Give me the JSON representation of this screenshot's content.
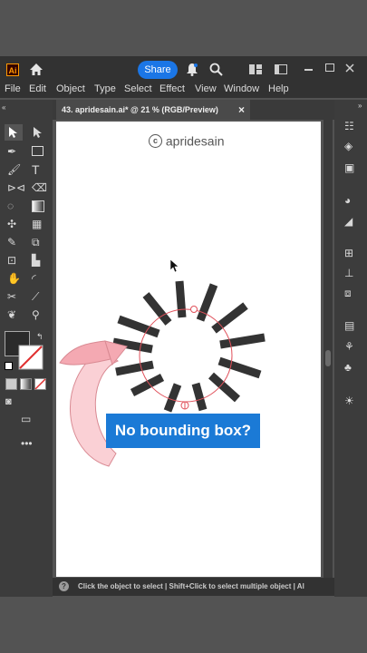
{
  "app": {
    "logo": "Ai",
    "share_label": "Share"
  },
  "menu": [
    "File",
    "Edit",
    "Object",
    "Type",
    "Select",
    "Effect",
    "View",
    "Window",
    "Help"
  ],
  "document": {
    "tab_title": "43. apridesain.ai* @ 21 % (RGB/Preview)",
    "close_glyph": "×"
  },
  "artboard": {
    "watermark": "apridesain",
    "callout": "No bounding box?"
  },
  "status": {
    "text": "Click the object to select  |  Shift+Click to select multiple object  |  Al"
  },
  "colors": {
    "accent": "#1b7ad6",
    "selection": "#e0505a",
    "bars": "#333333",
    "arrow": "#f4a9b2"
  },
  "icons": [
    "home-icon",
    "bell-icon",
    "search-icon",
    "selection-tool-icon",
    "direct-selection-icon",
    "pen-icon",
    "rectangle-icon",
    "brush-icon",
    "type-icon",
    "shaper-icon",
    "eraser-icon",
    "lasso-icon",
    "gradient-icon",
    "eyedropper-icon",
    "hand-icon",
    "zoom-icon",
    "fill-stroke-icon",
    "properties-icon",
    "layers-icon",
    "libraries-icon",
    "color-icon",
    "swatches-icon",
    "align-icon",
    "pathfinder-icon",
    "transform-icon",
    "symbols-icon",
    "appearance-icon",
    "brightness-icon"
  ]
}
